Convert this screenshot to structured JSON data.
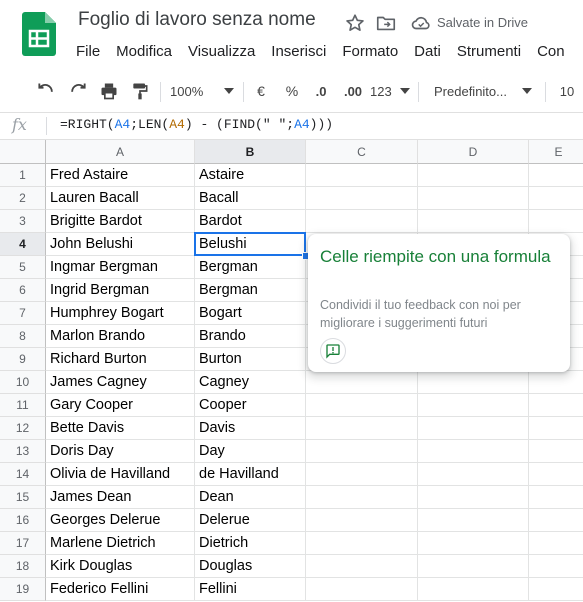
{
  "header": {
    "title": "Foglio di lavoro senza nome",
    "saved_status": "Salvate in Drive",
    "menu": [
      "File",
      "Modifica",
      "Visualizza",
      "Inserisci",
      "Formato",
      "Dati",
      "Strumenti",
      "Con"
    ]
  },
  "toolbar": {
    "zoom": "100%",
    "currency": "€",
    "percent": "%",
    "decimal_decrease": ".0",
    "decimal_increase": ".00",
    "number_format": "123",
    "font": "Predefinito...",
    "font_size": "10"
  },
  "formula_bar": {
    "fx_label": "fx",
    "formula": "=RIGHT(A4;LEN(A4) - (FIND(\" \";A4)))"
  },
  "grid": {
    "columns": [
      "A",
      "B",
      "C",
      "D",
      "E"
    ],
    "active_cell": "B4",
    "rows": [
      {
        "num": "1",
        "a": "Fred Astaire",
        "b": "Astaire"
      },
      {
        "num": "2",
        "a": "Lauren Bacall",
        "b": "Bacall"
      },
      {
        "num": "3",
        "a": "Brigitte Bardot",
        "b": "Bardot"
      },
      {
        "num": "4",
        "a": "John Belushi",
        "b": "Belushi"
      },
      {
        "num": "5",
        "a": "Ingmar Bergman",
        "b": "Bergman"
      },
      {
        "num": "6",
        "a": "Ingrid Bergman",
        "b": "Bergman"
      },
      {
        "num": "7",
        "a": "Humphrey Bogart",
        "b": "Bogart"
      },
      {
        "num": "8",
        "a": "Marlon Brando",
        "b": "Brando"
      },
      {
        "num": "9",
        "a": "Richard Burton",
        "b": "Burton"
      },
      {
        "num": "10",
        "a": "James Cagney",
        "b": "Cagney"
      },
      {
        "num": "11",
        "a": "Gary Cooper",
        "b": "Cooper"
      },
      {
        "num": "12",
        "a": "Bette Davis",
        "b": "Davis"
      },
      {
        "num": "13",
        "a": "Doris Day",
        "b": "Day"
      },
      {
        "num": "14",
        "a": "Olivia de Havilland",
        "b": "de Havilland"
      },
      {
        "num": "15",
        "a": "James Dean",
        "b": "Dean"
      },
      {
        "num": "16",
        "a": "Georges Delerue",
        "b": "Delerue"
      },
      {
        "num": "17",
        "a": "Marlene Dietrich",
        "b": "Dietrich"
      },
      {
        "num": "18",
        "a": "Kirk Douglas",
        "b": "Douglas"
      },
      {
        "num": "19",
        "a": "Federico Fellini",
        "b": "Fellini"
      }
    ]
  },
  "popup": {
    "title": "Celle riempite con una formula",
    "text": "Condividi il tuo feedback con noi per migliorare i suggerimenti futuri"
  },
  "colors": {
    "accent": "#1a73e8",
    "popup_title": "#188038",
    "sheets_green": "#0f9d58"
  }
}
